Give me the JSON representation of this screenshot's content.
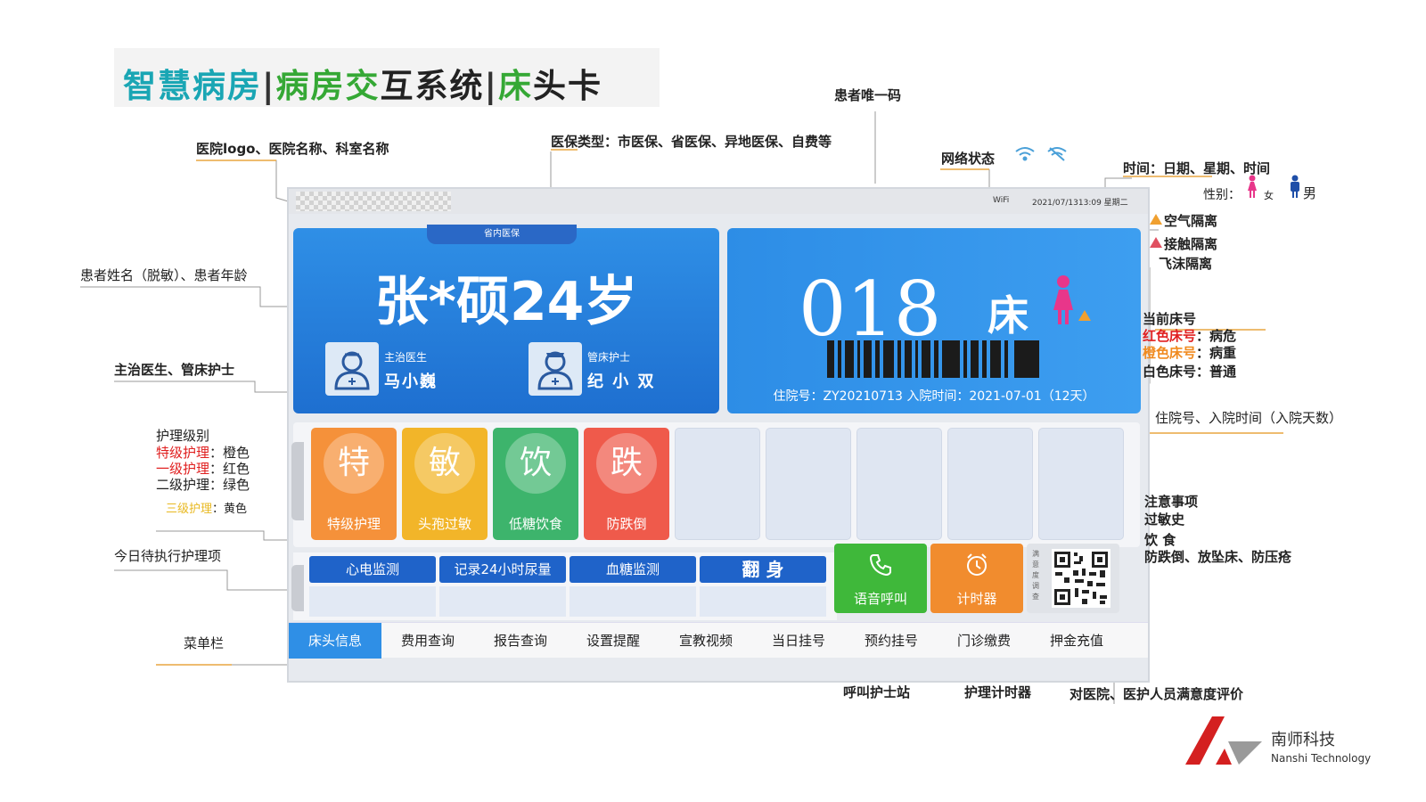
{
  "title": {
    "part1": "智慧病房",
    "sep1": "|",
    "part2a": "病房",
    "part2b": "交",
    "part2c": "互系统",
    "sep2": "|",
    "part3a": "床",
    "part3b": "头卡"
  },
  "topbar": {
    "wifi": "WiFi",
    "datetime": "2021/07/1313:09  星期二"
  },
  "patient": {
    "insurance_badge": "省内医保",
    "name_age": "张*硕24岁",
    "doctor_role": "主治医生",
    "doctor_name": "马小巍",
    "nurse_role": "管床护士",
    "nurse_name": "纪 小 双"
  },
  "bed": {
    "number": "018",
    "label": "床",
    "admission_line": "住院号：ZY20210713  入院时间：2021-07-01（12天）"
  },
  "nursing_tiles": [
    {
      "char": "特",
      "label": "特级护理",
      "color": "#f5913a"
    },
    {
      "char": "敏",
      "label": "头孢过敏",
      "color": "#f2b529"
    },
    {
      "char": "饮",
      "label": "低糖饮食",
      "color": "#3db46c"
    },
    {
      "char": "跌",
      "label": "防跌倒",
      "color": "#ef5a4b"
    }
  ],
  "tasks": [
    "心电监测",
    "记录24小时尿量",
    "血糖监测",
    "翻    身"
  ],
  "buttons": {
    "call": "语音呼叫",
    "timer": "计时器",
    "survey": "满意度调查"
  },
  "menu": [
    "床头信息",
    "费用查询",
    "报告查询",
    "设置提醒",
    "宣教视频",
    "当日挂号",
    "预约挂号",
    "门诊缴费",
    "押金充值"
  ],
  "annotations": {
    "hospital_logo": "医院logo、医院名称、科室名称",
    "insurance_type": "医保类型：市医保、省医保、异地医保、自费等",
    "patient_id": "患者唯一码",
    "network": "网络状态",
    "time": "时间：日期、星期、时间",
    "gender_label": "性别：",
    "female": "女",
    "male": "男",
    "isolation_air": "空气隔离",
    "isolation_contact": "接触隔离",
    "isolation_droplet": "飞沫隔离",
    "patient_name": "患者姓名（脱敏）、患者年龄",
    "doctor_nurse": "主治医生、管床护士",
    "bed_title": "当前床号",
    "bed_red": "红色床号",
    "bed_red_desc": "：病危",
    "bed_orange": "橙色床号",
    "bed_orange_desc": "：病重",
    "bed_white": "白色床号：普通",
    "admission": "住院号、入院时间（入院天数）",
    "nursing_level": "护理级别",
    "nl_special": "特级护理",
    "nl_special_desc": "：橙色",
    "nl_first": "一级护理",
    "nl_first_desc": "：红色",
    "nl_second": "二级护理：绿色",
    "nl_third": "三级护理",
    "nl_third_desc": "：黄色",
    "notes_title": "注意事项",
    "notes_allergy": "过敏史",
    "notes_diet": "饮 食",
    "notes_prevent": "防跌倒、放坠床、防压疮",
    "today_tasks": "今日待执行护理项",
    "menu_bar": "菜单栏",
    "call_station": "呼叫护士站",
    "nurse_timer": "护理计时器",
    "satisfaction": "对医院、医护人员满意度评价"
  },
  "brand": {
    "cn": "南师科技",
    "en": "Nanshi Technology"
  }
}
